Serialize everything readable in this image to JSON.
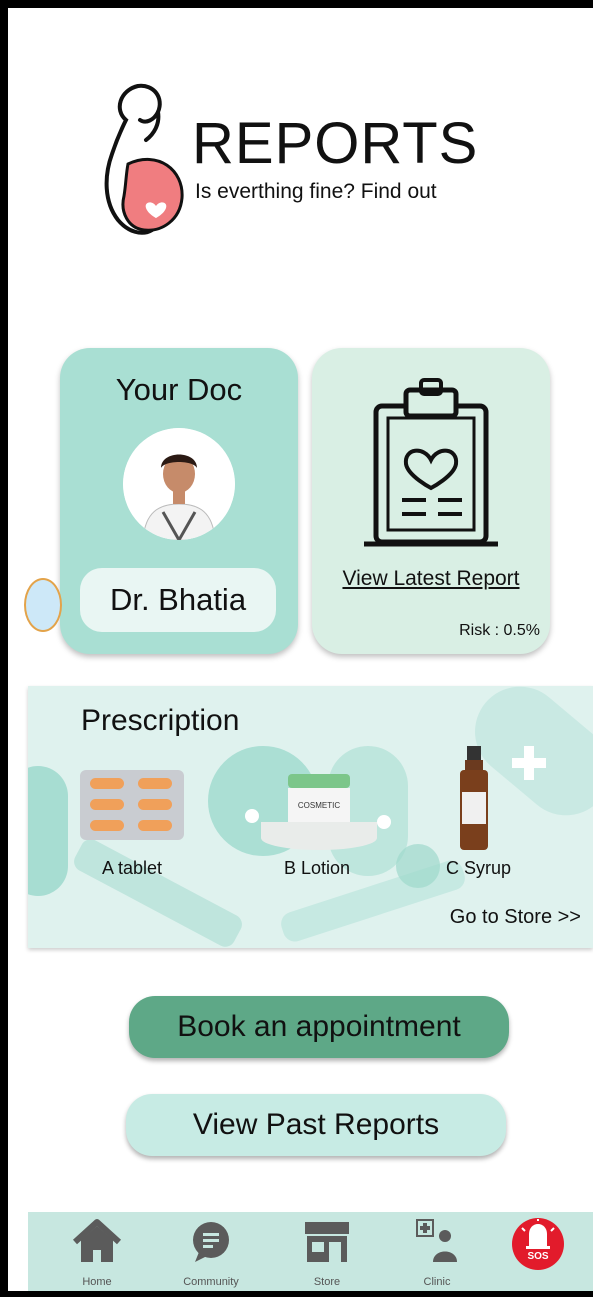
{
  "header": {
    "title": "REPORTS",
    "subtitle": "Is everthing fine? Find out"
  },
  "doctor_card": {
    "label": "Your Doc",
    "name": "Dr. Bhatia"
  },
  "report_card": {
    "link": "View Latest Report",
    "risk": "Risk : 0.5%"
  },
  "prescription": {
    "heading": "Prescription",
    "items": [
      {
        "label": "A tablet"
      },
      {
        "label": "B Lotion"
      },
      {
        "label": "C Syrup"
      }
    ],
    "store_link": "Go to Store >>",
    "lotion_brand": "COSMETIC"
  },
  "actions": {
    "book": "Book an appointment",
    "past": "View Past Reports"
  },
  "nav": {
    "items": [
      {
        "label": "Home",
        "icon": "home-icon"
      },
      {
        "label": "Community",
        "icon": "chat-icon"
      },
      {
        "label": "Store",
        "icon": "store-icon"
      },
      {
        "label": "Clinic",
        "icon": "clinic-icon"
      }
    ],
    "sos": "SOS"
  },
  "colors": {
    "mint": "#a9dfd3",
    "accent_green": "#5ea887",
    "sos_red": "#e21b2b"
  }
}
